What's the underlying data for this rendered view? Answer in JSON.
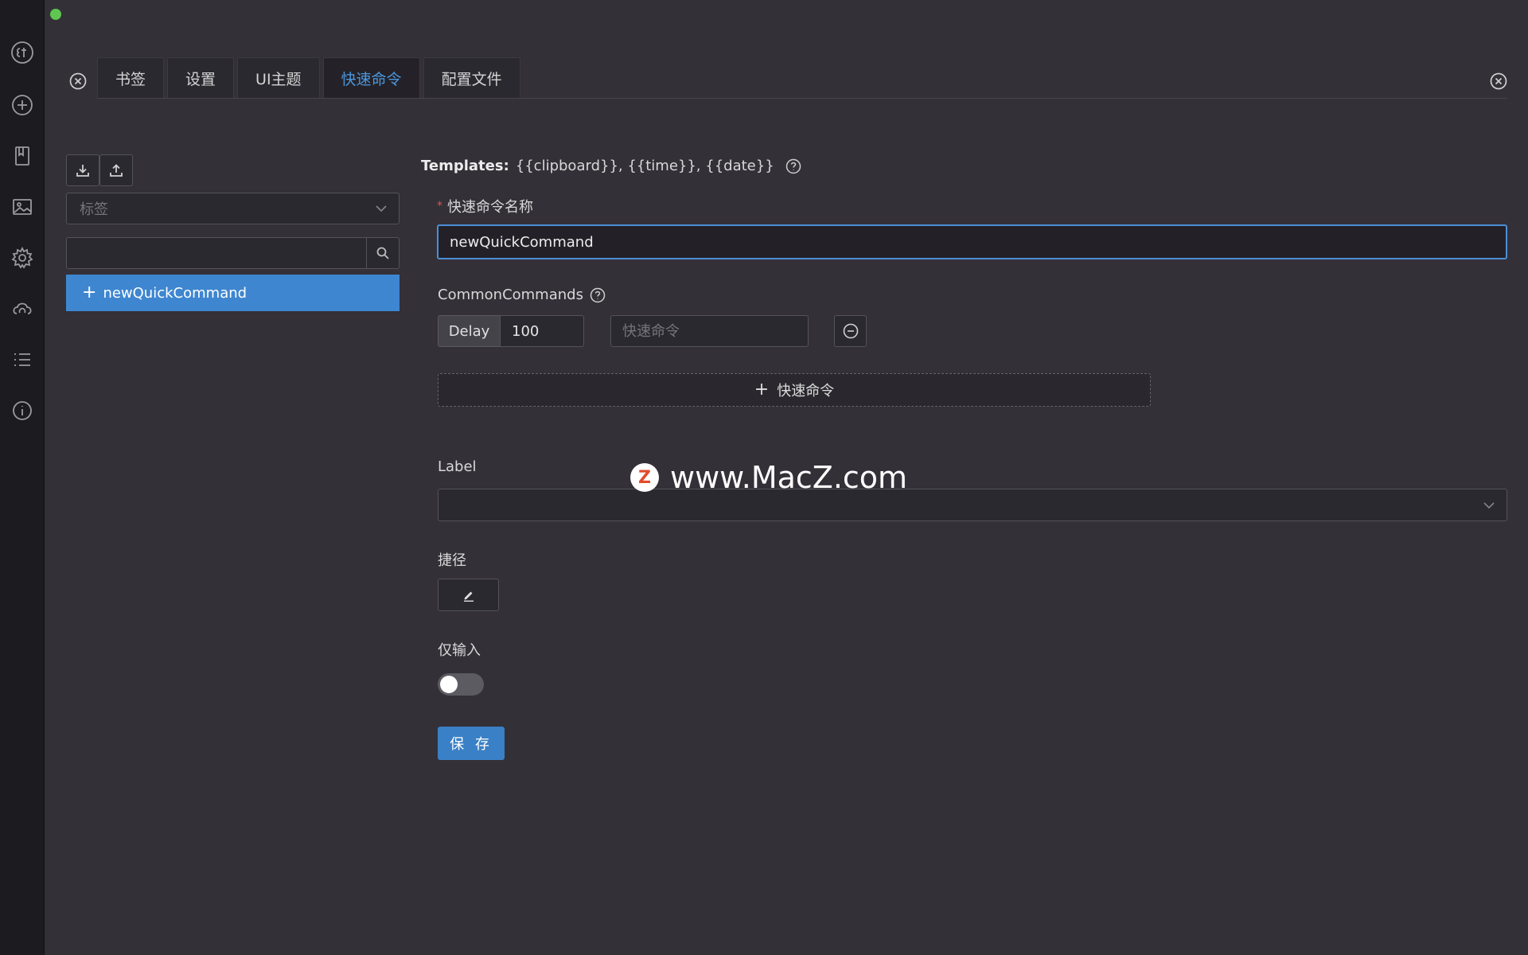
{
  "tabs": [
    {
      "label": "书签"
    },
    {
      "label": "设置"
    },
    {
      "label": "UI主题"
    },
    {
      "label": "快速命令",
      "active": true
    },
    {
      "label": "配置文件"
    }
  ],
  "left_panel": {
    "tag_select_placeholder": "标签",
    "search_value": "",
    "items": [
      {
        "label": "newQuickCommand"
      }
    ]
  },
  "form": {
    "templates_label": "Templates:",
    "templates_value": "{{clipboard}}, {{time}}, {{date}}",
    "name_label": "快速命令名称",
    "name_value": "newQuickCommand",
    "common_commands_label": "CommonCommands",
    "delay_label": "Delay",
    "delay_value": "100",
    "command_placeholder": "快速命令",
    "add_command_label": "快速命令",
    "label_label": "Label",
    "label_value": "",
    "shortcut_label": "捷径",
    "input_only_label": "仅输入",
    "input_only_checked": false,
    "save_label": "保 存"
  },
  "watermark": {
    "logo_letter": "Z",
    "text": "www.MacZ.com"
  },
  "colors": {
    "accent": "#3e86d0",
    "active_tab_text": "#4b97df",
    "background": "#333038",
    "required": "#e0524d"
  }
}
